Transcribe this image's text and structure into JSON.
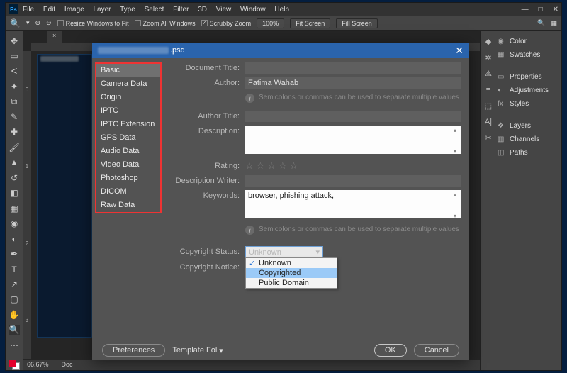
{
  "menu": {
    "items": [
      "File",
      "Edit",
      "Image",
      "Layer",
      "Type",
      "Select",
      "Filter",
      "3D",
      "View",
      "Window",
      "Help"
    ]
  },
  "optbar": {
    "resize": "Resize Windows to Fit",
    "zoomall": "Zoom All Windows",
    "scrubby": "Scrubby Zoom",
    "pct": "100%",
    "fit": "Fit Screen",
    "fill": "Fill Screen"
  },
  "ruler_v": [
    "0",
    "1",
    "2",
    "3"
  ],
  "status": {
    "zoom": "66.67%",
    "doc": "Doc"
  },
  "rpanel": {
    "items": [
      "Color",
      "Swatches",
      "Properties",
      "Adjustments",
      "Styles",
      "Layers",
      "Channels",
      "Paths"
    ]
  },
  "dialog": {
    "title_suffix": ".psd",
    "side": [
      "Basic",
      "Camera Data",
      "Origin",
      "IPTC",
      "IPTC Extension",
      "GPS Data",
      "Audio Data",
      "Video Data",
      "Photoshop",
      "DICOM",
      "Raw Data"
    ],
    "labels": {
      "doc_title": "Document Title:",
      "author": "Author:",
      "author_title": "Author Title:",
      "description": "Description:",
      "rating": "Rating:",
      "desc_writer": "Description Writer:",
      "keywords": "Keywords:",
      "copyright_status": "Copyright Status:",
      "copyright_notice": "Copyright Notice:"
    },
    "values": {
      "author": "Fatima Wahab",
      "keywords": "browser, phishing attack,",
      "copyright_status": "Unknown"
    },
    "hint": "Semicolons or commas can be used to separate multiple values",
    "dd_options": [
      "Unknown",
      "Copyrighted",
      "Public Domain"
    ],
    "footer": {
      "prefs": "Preferences",
      "tmpl": "Template Fol",
      "ok": "OK",
      "cancel": "Cancel"
    }
  }
}
